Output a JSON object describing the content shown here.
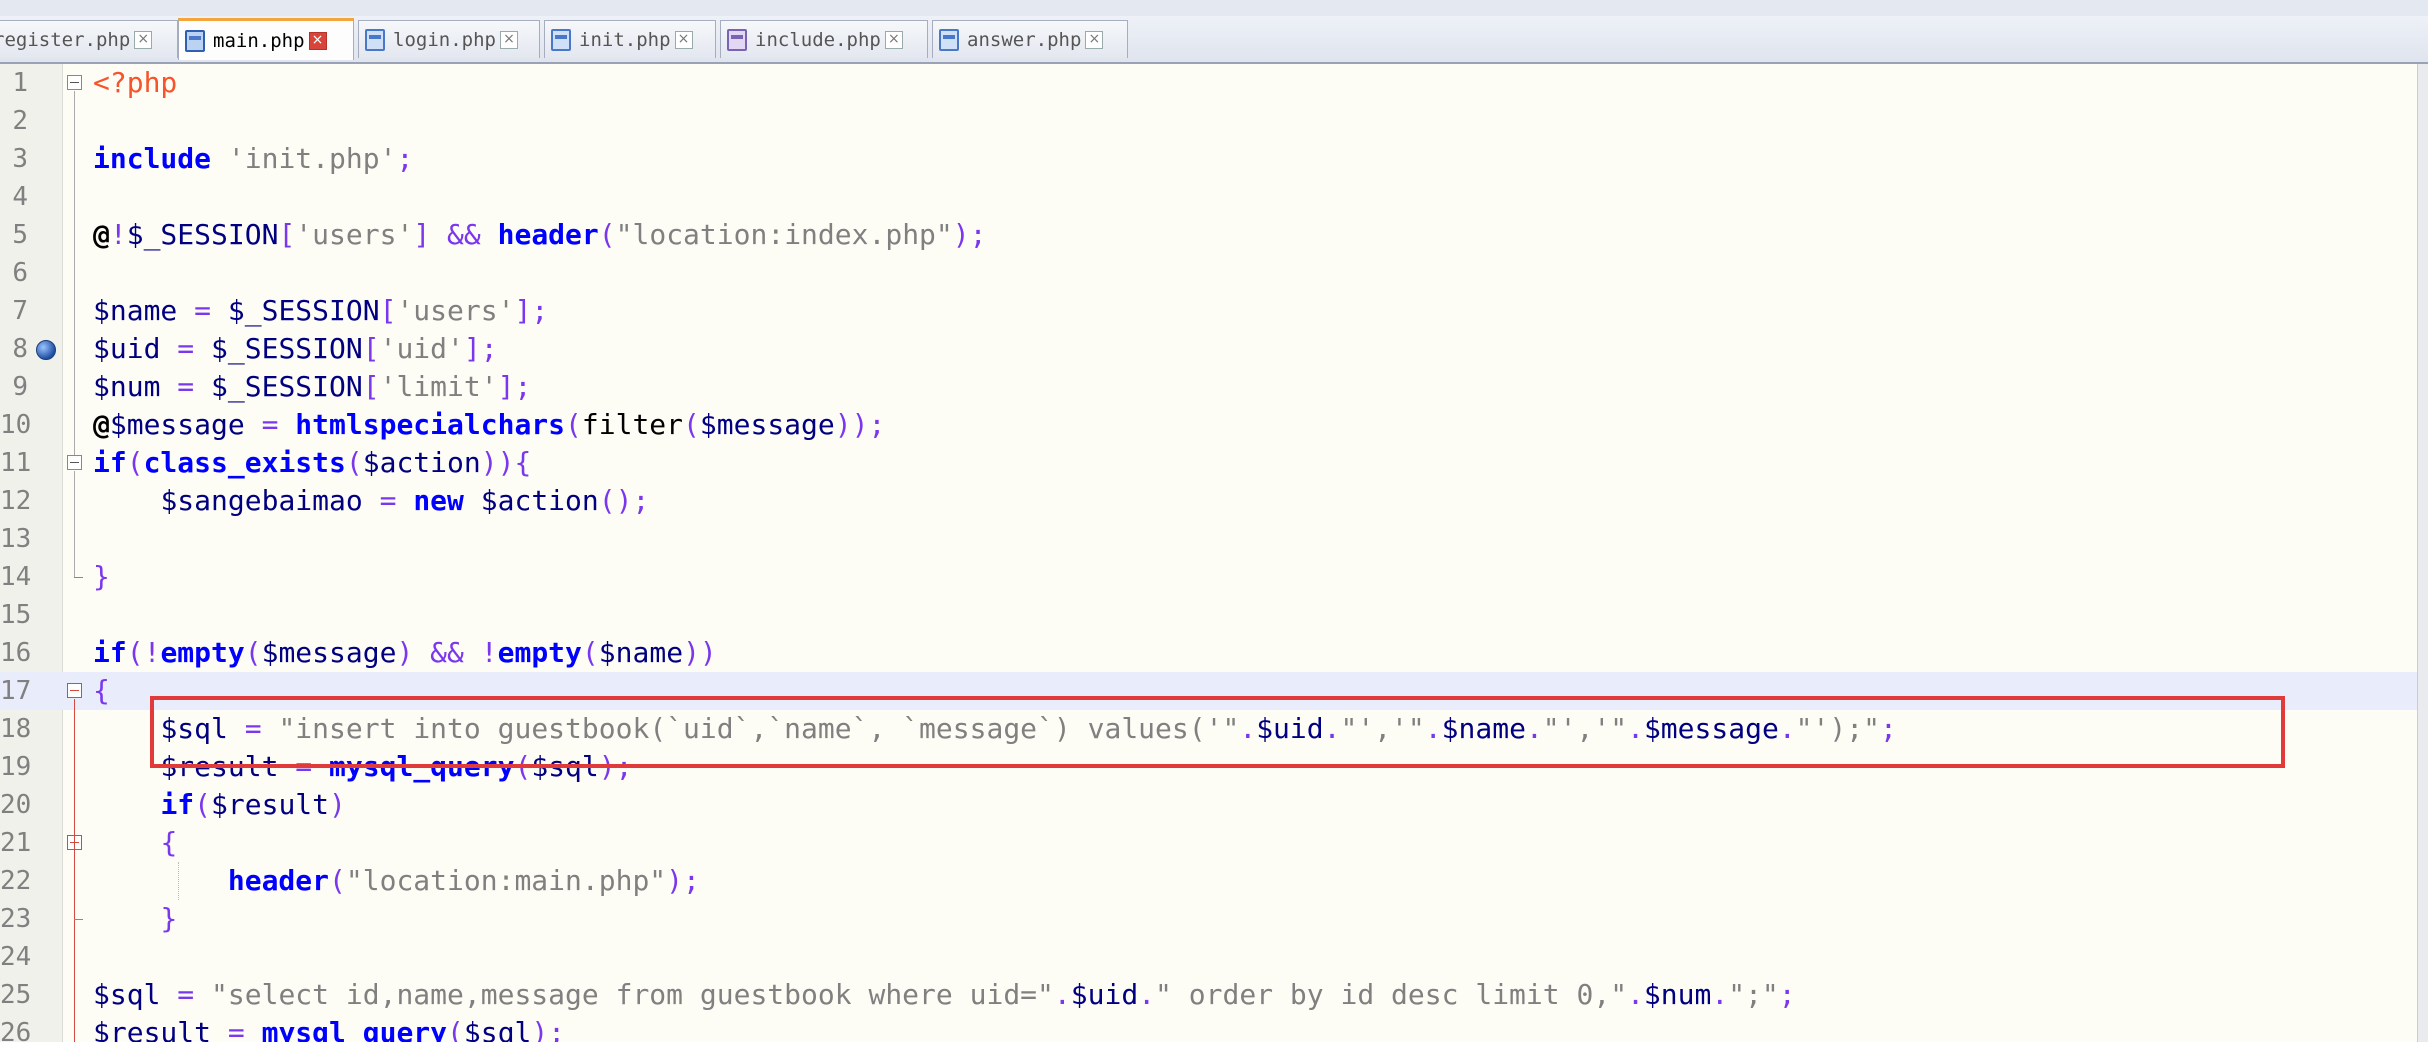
{
  "tabs": [
    {
      "label": "register.php",
      "icon": "file-icon",
      "active": false
    },
    {
      "label": "main.php",
      "icon": "file-icon",
      "active": true
    },
    {
      "label": "login.php",
      "icon": "file-icon",
      "active": false
    },
    {
      "label": "init.php",
      "icon": "file-icon",
      "active": false
    },
    {
      "label": "include.php",
      "icon": "file-purple-icon",
      "active": false
    },
    {
      "label": "answer.php",
      "icon": "file-icon",
      "active": false
    }
  ],
  "tab_close_glyph": "×",
  "editor": {
    "highlighted_line": 17,
    "bookmark_line": 8,
    "boxed_line": 18,
    "lines": [
      {
        "n": "1",
        "tokens": [
          [
            "php",
            "<?php"
          ]
        ]
      },
      {
        "n": "2",
        "tokens": []
      },
      {
        "n": "3",
        "tokens": [
          [
            "kw",
            "include"
          ],
          [
            "plain",
            " "
          ],
          [
            "str",
            "'init.php'"
          ],
          [
            "op",
            ";"
          ]
        ]
      },
      {
        "n": "4",
        "tokens": []
      },
      {
        "n": "5",
        "tokens": [
          [
            "at",
            "@"
          ],
          [
            "op",
            "!"
          ],
          [
            "var",
            "$_SESSION"
          ],
          [
            "op",
            "["
          ],
          [
            "str",
            "'users'"
          ],
          [
            "op",
            "] && "
          ],
          [
            "kw",
            "header"
          ],
          [
            "op",
            "("
          ],
          [
            "str",
            "\"location:index.php\""
          ],
          [
            "op",
            ");"
          ]
        ]
      },
      {
        "n": "6",
        "tokens": []
      },
      {
        "n": "7",
        "tokens": [
          [
            "var",
            "$name"
          ],
          [
            "op",
            " = "
          ],
          [
            "var",
            "$_SESSION"
          ],
          [
            "op",
            "["
          ],
          [
            "str",
            "'users'"
          ],
          [
            "op",
            "];"
          ]
        ]
      },
      {
        "n": "8",
        "tokens": [
          [
            "var",
            "$uid"
          ],
          [
            "op",
            " = "
          ],
          [
            "var",
            "$_SESSION"
          ],
          [
            "op",
            "["
          ],
          [
            "str",
            "'uid'"
          ],
          [
            "op",
            "];"
          ]
        ]
      },
      {
        "n": "9",
        "tokens": [
          [
            "var",
            "$num"
          ],
          [
            "op",
            " = "
          ],
          [
            "var",
            "$_SESSION"
          ],
          [
            "op",
            "["
          ],
          [
            "str",
            "'limit'"
          ],
          [
            "op",
            "];"
          ]
        ]
      },
      {
        "n": "10",
        "tokens": [
          [
            "at",
            "@"
          ],
          [
            "var",
            "$message"
          ],
          [
            "op",
            " = "
          ],
          [
            "kw",
            "htmlspecialchars"
          ],
          [
            "op",
            "("
          ],
          [
            "plain",
            "filter"
          ],
          [
            "op",
            "("
          ],
          [
            "var",
            "$message"
          ],
          [
            "op",
            "));"
          ]
        ]
      },
      {
        "n": "11",
        "tokens": [
          [
            "kw",
            "if"
          ],
          [
            "op",
            "("
          ],
          [
            "kw",
            "class_exists"
          ],
          [
            "op",
            "("
          ],
          [
            "var",
            "$action"
          ],
          [
            "op",
            ")){"
          ]
        ]
      },
      {
        "n": "12",
        "tokens": [
          [
            "plain",
            "    "
          ],
          [
            "var",
            "$sangebaimao"
          ],
          [
            "op",
            " = "
          ],
          [
            "kw",
            "new"
          ],
          [
            "plain",
            " "
          ],
          [
            "var",
            "$action"
          ],
          [
            "op",
            "();"
          ]
        ]
      },
      {
        "n": "13",
        "tokens": []
      },
      {
        "n": "14",
        "tokens": [
          [
            "op",
            "}"
          ]
        ]
      },
      {
        "n": "15",
        "tokens": []
      },
      {
        "n": "16",
        "tokens": [
          [
            "kw",
            "if"
          ],
          [
            "op",
            "(!"
          ],
          [
            "kw",
            "empty"
          ],
          [
            "op",
            "("
          ],
          [
            "var",
            "$message"
          ],
          [
            "op",
            ") && !"
          ],
          [
            "kw",
            "empty"
          ],
          [
            "op",
            "("
          ],
          [
            "var",
            "$name"
          ],
          [
            "op",
            "))"
          ]
        ]
      },
      {
        "n": "17",
        "tokens": [
          [
            "op",
            "{"
          ]
        ]
      },
      {
        "n": "18",
        "tokens": [
          [
            "plain",
            "    "
          ],
          [
            "var",
            "$sql"
          ],
          [
            "op",
            " = "
          ],
          [
            "str",
            "\"insert into guestbook(`uid`,`name`, `message`) values('\""
          ],
          [
            "op",
            "."
          ],
          [
            "var",
            "$uid"
          ],
          [
            "op",
            "."
          ],
          [
            "str",
            "\"','\""
          ],
          [
            "op",
            "."
          ],
          [
            "var",
            "$name"
          ],
          [
            "op",
            "."
          ],
          [
            "str",
            "\"','\""
          ],
          [
            "op",
            "."
          ],
          [
            "var",
            "$message"
          ],
          [
            "op",
            "."
          ],
          [
            "str",
            "\"');\""
          ],
          [
            "op",
            ";"
          ]
        ]
      },
      {
        "n": "19",
        "tokens": [
          [
            "plain",
            "    "
          ],
          [
            "var",
            "$result"
          ],
          [
            "op",
            " = "
          ],
          [
            "kw",
            "mysql_query"
          ],
          [
            "op",
            "("
          ],
          [
            "var",
            "$sql"
          ],
          [
            "op",
            ");"
          ]
        ]
      },
      {
        "n": "20",
        "tokens": [
          [
            "plain",
            "    "
          ],
          [
            "kw",
            "if"
          ],
          [
            "op",
            "("
          ],
          [
            "var",
            "$result"
          ],
          [
            "op",
            ")"
          ]
        ]
      },
      {
        "n": "21",
        "tokens": [
          [
            "plain",
            "    "
          ],
          [
            "op",
            "{"
          ]
        ]
      },
      {
        "n": "22",
        "tokens": [
          [
            "plain",
            "        "
          ],
          [
            "kw",
            "header"
          ],
          [
            "op",
            "("
          ],
          [
            "str",
            "\"location:main.php\""
          ],
          [
            "op",
            ");"
          ]
        ]
      },
      {
        "n": "23",
        "tokens": [
          [
            "plain",
            "    "
          ],
          [
            "op",
            "}"
          ]
        ]
      },
      {
        "n": "24",
        "tokens": []
      },
      {
        "n": "25",
        "tokens": [
          [
            "var",
            "$sql"
          ],
          [
            "op",
            " = "
          ],
          [
            "str",
            "\"select id,name,message from guestbook where uid=\""
          ],
          [
            "op",
            "."
          ],
          [
            "var",
            "$uid"
          ],
          [
            "op",
            "."
          ],
          [
            "str",
            "\" order by id desc limit 0,\""
          ],
          [
            "op",
            "."
          ],
          [
            "var",
            "$num"
          ],
          [
            "op",
            "."
          ],
          [
            "str",
            "\";\""
          ],
          [
            "op",
            ";"
          ]
        ]
      },
      {
        "n": "26",
        "tokens": [
          [
            "var",
            "$result"
          ],
          [
            "op",
            " = "
          ],
          [
            "kw",
            "mysql_query"
          ],
          [
            "op",
            "("
          ],
          [
            "var",
            "$sql"
          ],
          [
            "op",
            ");"
          ]
        ]
      }
    ]
  }
}
